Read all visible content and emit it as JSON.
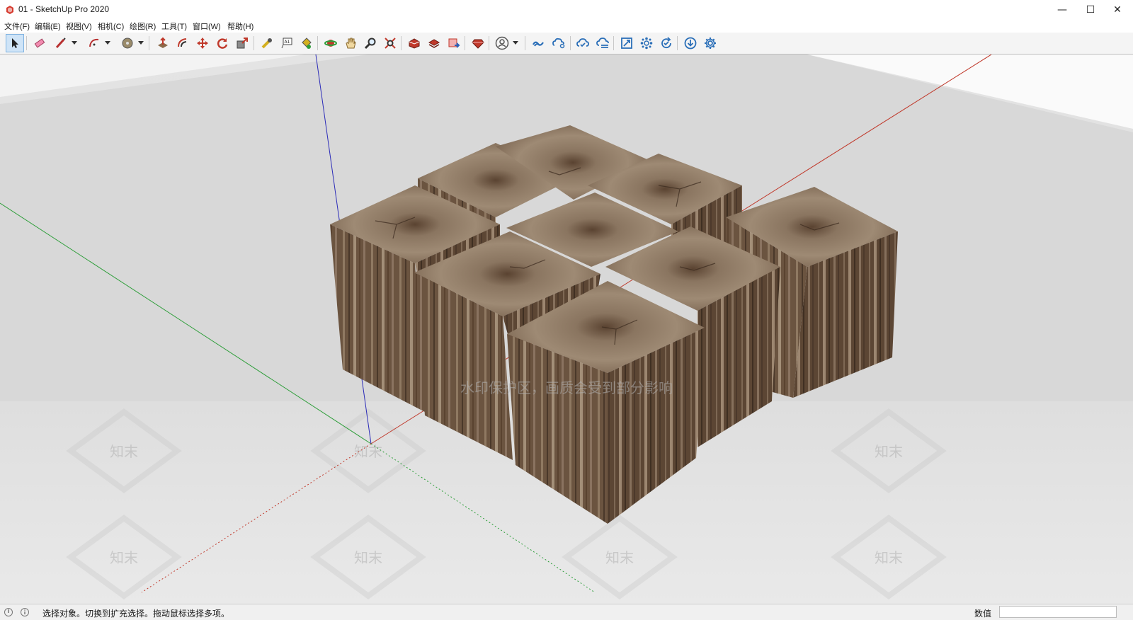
{
  "window": {
    "title": "01 - SketchUp Pro 2020",
    "minimize_glyph": "—",
    "maximize_glyph": "☐",
    "close_glyph": "✕",
    "app_icon": "sketchup-logo-icon"
  },
  "menu": {
    "items": [
      "文件(F)",
      "编辑(E)",
      "视图(V)",
      "相机(C)",
      "绘图(R)",
      "工具(T)",
      "窗口(W)",
      "帮助(H)"
    ]
  },
  "toolbar": {
    "tools": [
      "select-tool-icon",
      "eraser-tool-icon",
      "line-tool-icon",
      "arc-tool-icon",
      "shapes-tool-icon",
      "push-pull-tool-icon",
      "offset-tool-icon",
      "move-tool-icon",
      "rotate-tool-icon",
      "scale-tool-icon",
      "tape-measure-tool-icon",
      "text-tool-icon",
      "paint-bucket-tool-icon",
      "orbit-tool-icon",
      "pan-tool-icon",
      "zoom-tool-icon",
      "zoom-extents-tool-icon",
      "3d-warehouse-icon",
      "extension-warehouse-icon",
      "layout-send-icon",
      "ruby-extension-icon",
      "profile-icon",
      "trimble-connect-icon",
      "trimble-share-icon",
      "cloud-sync-icon",
      "cloud-upload-icon",
      "component-frame-icon",
      "component-network-icon",
      "refresh-check-icon",
      "download-icon",
      "settings-gear-icon"
    ],
    "active_tool": "select-tool-icon"
  },
  "viewport": {
    "watermark_line": "水印保护区，画质会受到部分影响",
    "watermark_logo": "知末",
    "axis_colors": {
      "red": "#c0392b",
      "green": "#2e9e3a",
      "blue": "#2b2bb8"
    },
    "model_description_colors": {
      "wood_dark": "#5a4330",
      "wood_mid": "#7a5e45",
      "wood_light": "#a08a73"
    }
  },
  "status": {
    "message": "选择对象。切换到扩充选择。拖动鼠标选择多项。",
    "measurement_label": "数值",
    "measurement_value": ""
  }
}
